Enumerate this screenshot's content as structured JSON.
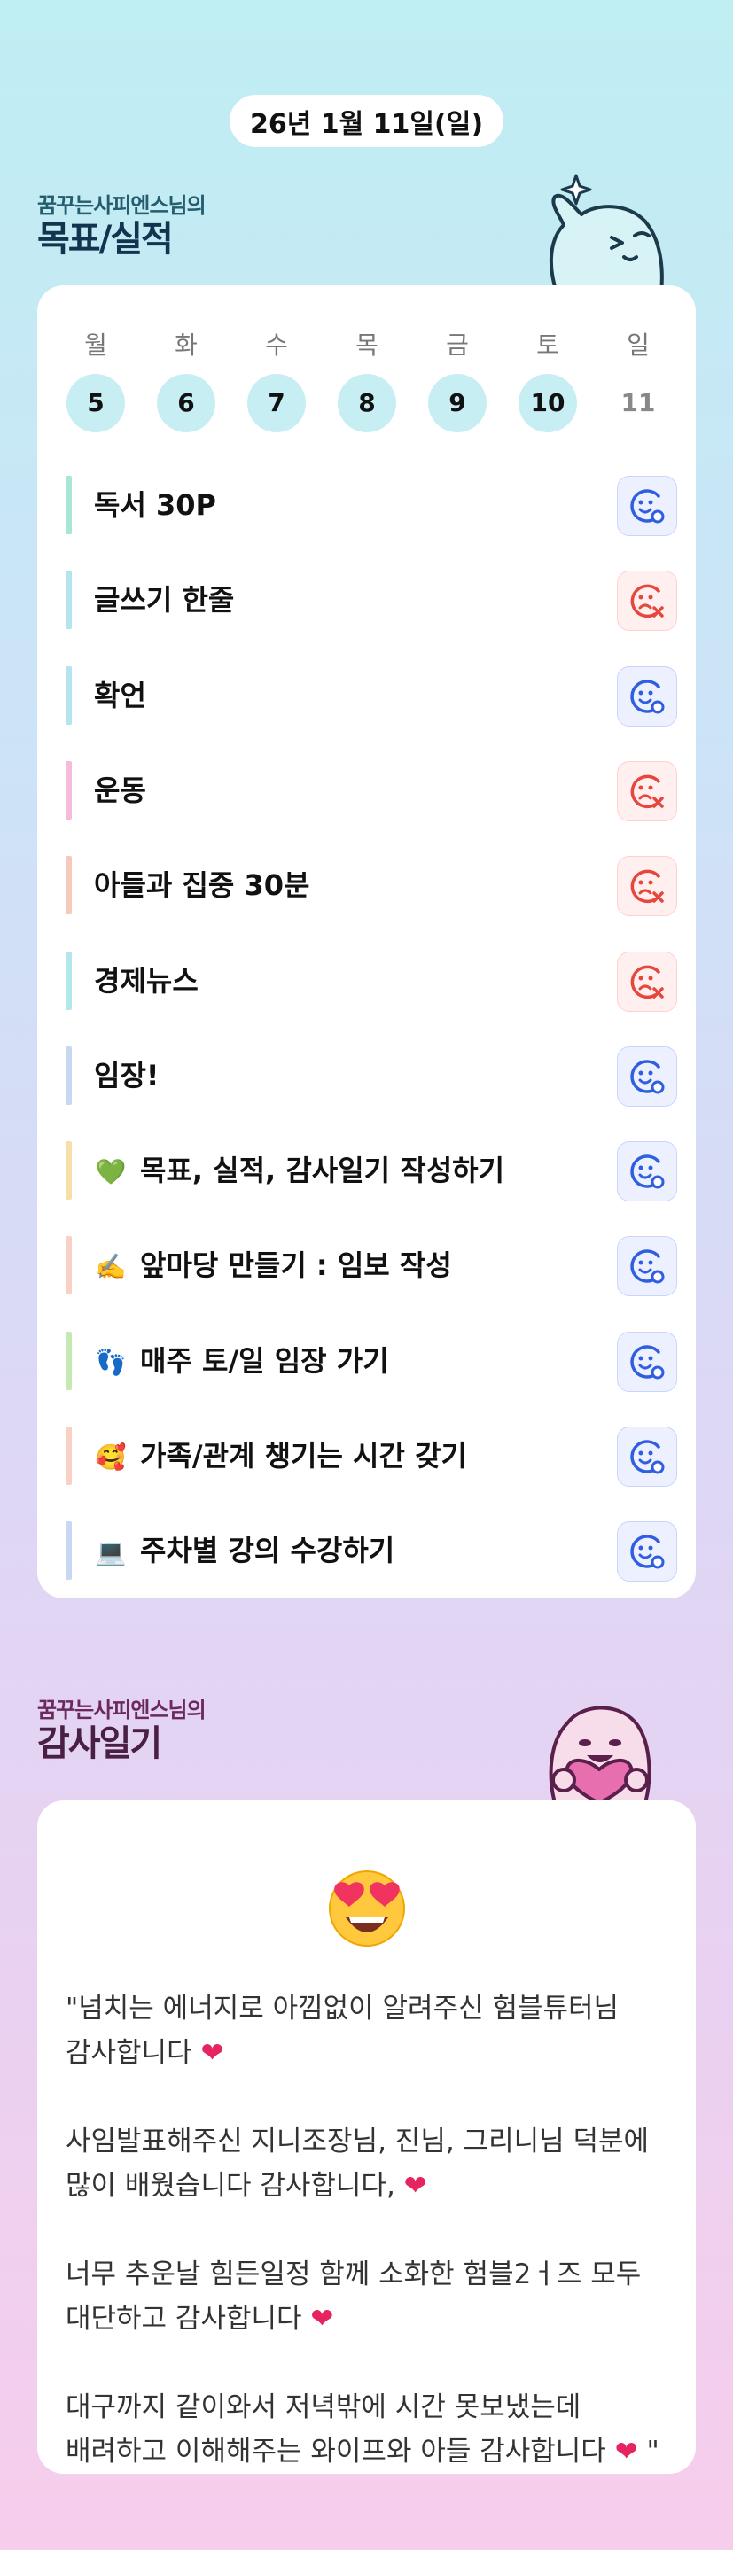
{
  "date": "26년 1월 11일(일)",
  "goal_section": {
    "subtitle": "꿈꾸는사피엔스님의",
    "title": "목표/실적"
  },
  "week": [
    {
      "day": "월",
      "num": "5",
      "active": true
    },
    {
      "day": "화",
      "num": "6",
      "active": true
    },
    {
      "day": "수",
      "num": "7",
      "active": true
    },
    {
      "day": "목",
      "num": "8",
      "active": true
    },
    {
      "day": "금",
      "num": "9",
      "active": true
    },
    {
      "day": "토",
      "num": "10",
      "active": true
    },
    {
      "day": "일",
      "num": "11",
      "active": false
    }
  ],
  "goals": [
    {
      "text": "독서 30P",
      "emoji": "",
      "bar": "#a8e6d8",
      "status": "done"
    },
    {
      "text": "글쓰기 한줄",
      "emoji": "",
      "bar": "#b3e4ef",
      "status": "fail"
    },
    {
      "text": "확언",
      "emoji": "",
      "bar": "#b3e4ef",
      "status": "done"
    },
    {
      "text": "운동",
      "emoji": "",
      "bar": "#f4bcd8",
      "status": "fail"
    },
    {
      "text": "아들과 집중 30분",
      "emoji": "",
      "bar": "#f7c9bb",
      "status": "fail"
    },
    {
      "text": "경제뉴스",
      "emoji": "",
      "bar": "#b3e8ea",
      "status": "fail"
    },
    {
      "text": "임장!",
      "emoji": "",
      "bar": "#c9d8f2",
      "status": "done"
    },
    {
      "text": "목표, 실적, 감사일기 작성하기",
      "emoji": "💚",
      "bar": "#f7e0a8",
      "status": "done"
    },
    {
      "text": "앞마당 만들기 : 임보 작성",
      "emoji": "✍️",
      "bar": "#f9d0c4",
      "status": "done"
    },
    {
      "text": "매주 토/일 임장 가기",
      "emoji": "👣",
      "bar": "#c4eab2",
      "status": "done"
    },
    {
      "text": "가족/관계 챙기는 시간 갖기",
      "emoji": "🥰",
      "bar": "#f9d0c4",
      "status": "done"
    },
    {
      "text": "주차별 강의 수강하기",
      "emoji": "💻",
      "bar": "#c9d8f2",
      "status": "done"
    }
  ],
  "gratitude_section": {
    "subtitle": "꿈꾸는사피엔스님의",
    "title": "감사일기"
  },
  "gratitude": {
    "emoji": "😍",
    "paragraphs": [
      "\"넘치는 에너지로 아낌없이 알려주신 험블튜터님 감사합니다",
      "사임발표해주신 지니조장님, 진님, 그리니님 덕분에 많이 배웠습니다 감사합니다,",
      "너무 추운날 힘든일정 함께 소화한 험블2ㅓ즈 모두 대단하고 감사합니다",
      "대구까지 같이와서 저녁밖에 시간 못보냈는데 배려하고 이해해주는 와이프와 아들 감사합니다"
    ],
    "closing_quote": "\""
  },
  "colors": {
    "done": "#2f5fe0",
    "fail": "#e6463c",
    "accent_day": "#c6eef3"
  }
}
